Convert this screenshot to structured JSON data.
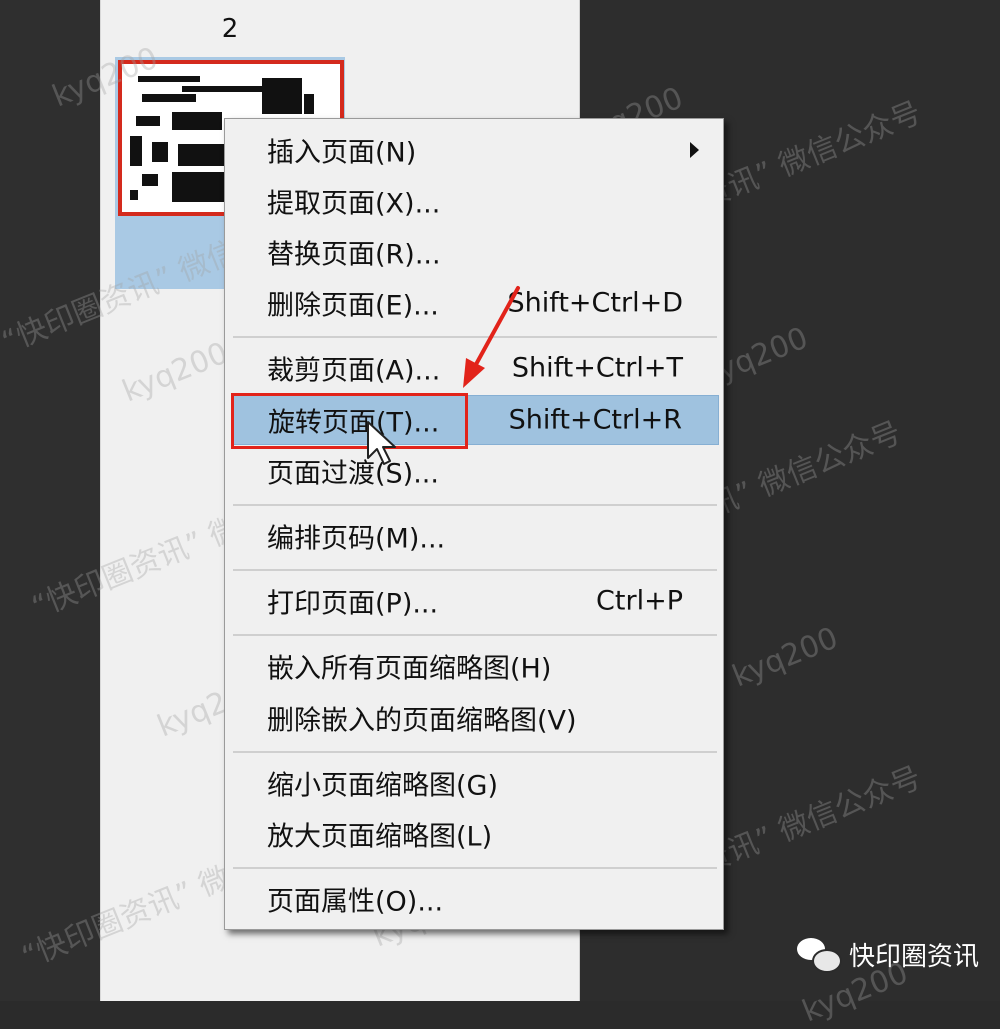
{
  "panel": {
    "page_number": "2"
  },
  "context_menu": {
    "items": [
      {
        "label": "插入页面(N)",
        "shortcut": "",
        "submenu": true
      },
      {
        "label": "提取页面(X)...",
        "shortcut": ""
      },
      {
        "label": "替换页面(R)...",
        "shortcut": ""
      },
      {
        "label": "删除页面(E)...",
        "shortcut": "Shift+Ctrl+D"
      },
      {
        "label": "裁剪页面(A)...",
        "shortcut": "Shift+Ctrl+T"
      },
      {
        "label": "旋转页面(T)...",
        "shortcut": "Shift+Ctrl+R",
        "highlighted": true
      },
      {
        "label": "页面过渡(S)...",
        "shortcut": ""
      },
      {
        "label": "编排页码(M)...",
        "shortcut": ""
      },
      {
        "label": "打印页面(P)...",
        "shortcut": "Ctrl+P"
      },
      {
        "label": "嵌入所有页面缩略图(H)",
        "shortcut": ""
      },
      {
        "label": "删除嵌入的页面缩略图(V)",
        "shortcut": ""
      },
      {
        "label": "缩小页面缩略图(G)",
        "shortcut": ""
      },
      {
        "label": "放大页面缩略图(L)",
        "shortcut": ""
      },
      {
        "label": "页面属性(O)...",
        "shortcut": ""
      }
    ]
  },
  "watermarks": {
    "handle": "kyq200",
    "wechat_text": "“快印圈资讯” 微信公众号"
  },
  "brand": {
    "name": "快印圈资讯",
    "icon": "wechat-icon"
  },
  "colors": {
    "highlight": "#9fc2df",
    "annotation_red": "#e2231a",
    "selection_blue": "#a9c9e4",
    "thumbnail_border": "#d42a1d"
  }
}
